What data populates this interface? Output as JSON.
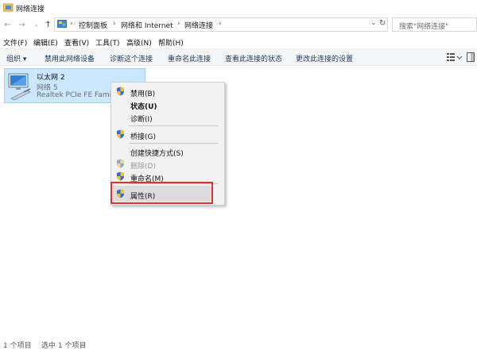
{
  "window": {
    "title": "网络连接"
  },
  "address": {
    "crumbs": [
      "控制面板",
      "网络和 Internet",
      "网络连接"
    ],
    "search_placeholder": "搜索\"网络连接\""
  },
  "menubar": {
    "file": "文件(F)",
    "edit": "编辑(E)",
    "view": "查看(V)",
    "tools": "工具(T)",
    "advanced": "高级(N)",
    "help": "帮助(H)"
  },
  "commandbar": {
    "organize": "组织 ▾",
    "disable": "禁用此网络设备",
    "diagnose": "诊断这个连接",
    "rename": "重命名此连接",
    "status": "查看此连接的状态",
    "settings": "更改此连接的设置"
  },
  "connection": {
    "name": "以太网 2",
    "network": "网络 5",
    "device": "Realtek PCIe FE Family"
  },
  "context_menu": {
    "disable": "禁用(B)",
    "status": "状态(U)",
    "diagnose": "诊断(I)",
    "bridge": "桥接(G)",
    "shortcut": "创建快捷方式(S)",
    "delete": "删除(D)",
    "rename": "重命名(M)",
    "properties": "属性(R)"
  },
  "statusbar": {
    "items": "1 个项目",
    "selected": "选中 1 个项目"
  },
  "colors": {
    "selection_bg": "#cce8ff",
    "highlight_box": "#e0322c",
    "command_text": "#1e395b"
  }
}
